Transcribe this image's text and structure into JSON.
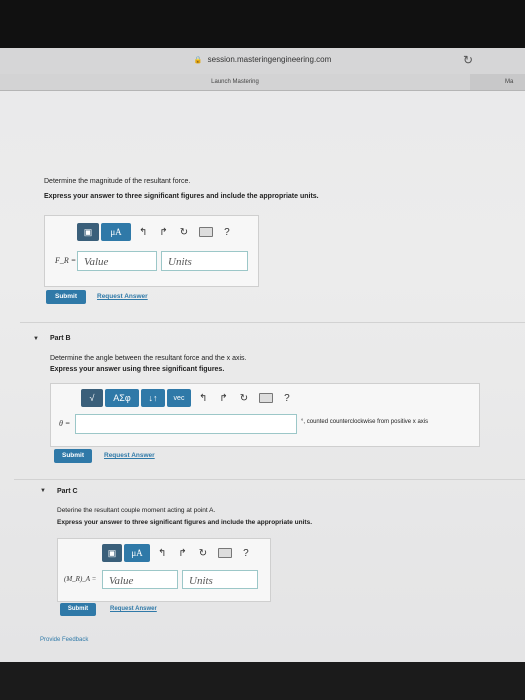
{
  "browser": {
    "url": "session.masteringengineering.com",
    "tab_label": "Launch Mastering",
    "next_tab_label": "Ma"
  },
  "part_a": {
    "question": "Determine the magnitude of the resultant force.",
    "instruction": "Express your answer to three significant figures and include the appropriate units.",
    "toolbar": {
      "mu_label": "μA",
      "help": "?"
    },
    "var_label": "F_R =",
    "value_placeholder": "Value",
    "units_placeholder": "Units",
    "submit": "Submit",
    "request": "Request Answer"
  },
  "part_b": {
    "title": "Part B",
    "question": "Determine the angle between the resultant force and the x axis.",
    "instruction": "Express your answer using three significant figures.",
    "toolbar": {
      "sqrt_label": "√",
      "greek_label": "ΑΣφ",
      "arrows_label": "↓↑",
      "vec_label": "vec",
      "help": "?"
    },
    "var_label": "θ =",
    "suffix": "°, counted counterclockwise from positive x axis",
    "submit": "Submit",
    "request": "Request Answer"
  },
  "part_c": {
    "title": "Part C",
    "question": "Deterine the resultant couple moment acting at point A.",
    "instruction": "Express your answer to three significant figures and include the appropriate units.",
    "toolbar": {
      "mu_label": "μA",
      "help": "?"
    },
    "var_label": "(M_R)_A =",
    "value_placeholder": "Value",
    "units_placeholder": "Units",
    "submit": "Submit",
    "request": "Request Answer"
  },
  "footer": {
    "provide_feedback": "Provide Feedback"
  },
  "colors": {
    "accent": "#2f79a8",
    "field_border": "#9cc7c8"
  }
}
